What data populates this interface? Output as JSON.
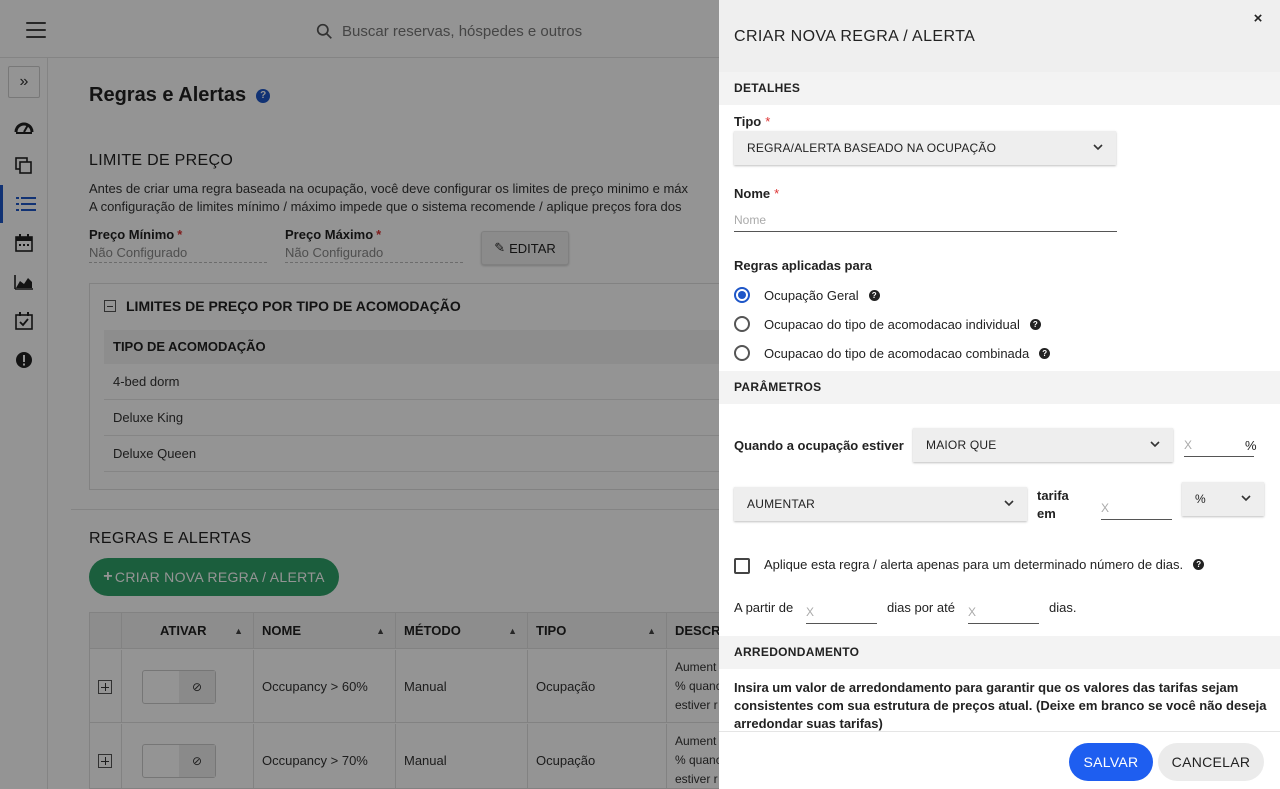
{
  "search": {
    "placeholder": "Buscar reservas, hóspedes e outros"
  },
  "page": {
    "title": "Regras e Alertas",
    "help": "?",
    "price_limit": {
      "heading": "LIMITE DE PREÇO",
      "desc_line1": "Antes de criar uma regra baseada na ocupação, você deve configurar os limites de preço minimo e máx",
      "desc_line2": "A configuração de limites mínimo / máximo impede que o sistema recomende / aplique preços fora dos",
      "min_label": "Preço Mínimo",
      "min_value": "Não Configurado",
      "max_label": "Preço Máximo",
      "max_value": "Não Configurado",
      "required": "*",
      "edit_label": "EDITAR"
    },
    "room_limits": {
      "heading": "LIMITES DE PREÇO POR TIPO DE ACOMODAÇÃO",
      "column": "TIPO DE ACOMODAÇÃO",
      "rows": [
        "4-bed dorm",
        "Deluxe King",
        "Deluxe Queen"
      ]
    },
    "rules": {
      "heading": "REGRAS E ALERTAS",
      "create_label": "CRIAR NOVA REGRA / ALERTA",
      "columns": [
        "ATIVAR",
        "NOME",
        "MÉTODO",
        "TIPO",
        "DESCRI"
      ],
      "rows": [
        {
          "name": "Occupancy > 60%",
          "method": "Manual",
          "type": "Ocupação",
          "desc1": "Aument",
          "desc2": "% quanc",
          "desc3": "estiver r"
        },
        {
          "name": "Occupancy > 70%",
          "method": "Manual",
          "type": "Ocupação",
          "desc1": "Aument",
          "desc2": "% quanc",
          "desc3": "estiver r"
        }
      ]
    }
  },
  "drawer": {
    "title": "CRIAR NOVA REGRA / ALERTA",
    "close": "×",
    "sections": {
      "details": "DETALHES",
      "params": "PARÂMETROS",
      "rounding": "ARREDONDAMENTO"
    },
    "type_label": "Tipo",
    "type_value": "REGRA/ALERTA BASEADO NA OCUPAÇÃO",
    "name_label": "Nome",
    "name_placeholder": "Nome",
    "required": "*",
    "applies_label": "Regras aplicadas para",
    "radios": [
      "Ocupação Geral",
      "Ocupacao do tipo de acomodacao individual",
      "Ocupacao do tipo de acomodacao combinada"
    ],
    "selected_radio": 0,
    "when_label": "Quando a ocupação estiver",
    "operator_value": "MAIOR QUE",
    "occ_placeholder": "X",
    "occ_unit": "%",
    "action_value": "AUMENTAR",
    "rate_label_1": "tarifa",
    "rate_label_2": "em",
    "rate_placeholder": "X",
    "rate_unit_value": "%",
    "days_checkbox_label": "Aplique esta regra / alerta apenas para um determinado número de dias.",
    "from_label": "A partir de",
    "from_placeholder": "X",
    "until_label": "dias por até",
    "until_placeholder": "X",
    "days_label": "dias.",
    "rounding_info": "Insira um valor de arredondamento para garantir que os valores das tarifas sejam consistentes com sua estrutura de preços atual. (Deixe em branco se você não deseja arredondar suas tarifas)",
    "save_label": "SALVAR",
    "cancel_label": "CANCELAR"
  },
  "colors": {
    "primary": "#1e5ef0",
    "accent_blue": "#1e56c8",
    "create_green": "#2fa36a",
    "required_red": "#dd3333",
    "overlay": "rgba(0,0,0,0.42)"
  },
  "icons": {
    "menu": "hamburger-icon",
    "search": "search-icon",
    "nav": [
      "expand-icon",
      "dashboard-icon",
      "copy-icon",
      "list-icon",
      "calendar-icon",
      "chart-icon",
      "calendar-check-icon",
      "alert-icon"
    ]
  }
}
